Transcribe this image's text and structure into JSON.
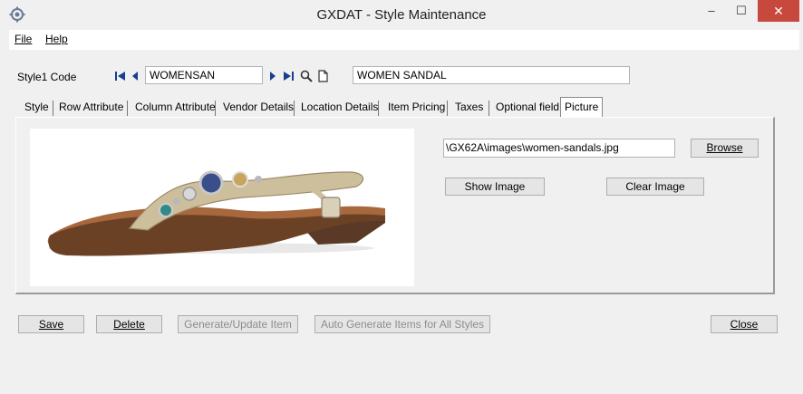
{
  "window": {
    "title": "GXDAT - Style Maintenance",
    "minimize": "–",
    "maximize": "☐",
    "close": "✕"
  },
  "menu": {
    "file": "File",
    "help": "Help"
  },
  "style_code": {
    "label": "Style1 Code",
    "code_value": "WOMENSAN",
    "description_value": "WOMEN SANDAL"
  },
  "tabs": [
    {
      "label": "Style",
      "active": false
    },
    {
      "label": "Row Attribute",
      "active": false
    },
    {
      "label": "Column Attribute",
      "active": false
    },
    {
      "label": "Vendor Details",
      "active": false
    },
    {
      "label": "Location Details",
      "active": false
    },
    {
      "label": "Item Pricing",
      "active": false
    },
    {
      "label": "Taxes",
      "active": false
    },
    {
      "label": "Optional field",
      "active": false
    },
    {
      "label": "Picture",
      "active": true
    }
  ],
  "picture": {
    "path_value": "\\GX62A\\images\\women-sandals.jpg",
    "browse_label": "Browse",
    "show_image_label": "Show Image",
    "clear_image_label": "Clear Image"
  },
  "actions": {
    "save_label": "Save",
    "delete_label": "Delete",
    "generate_update_label": "Generate/Update Item",
    "auto_generate_label": "Auto Generate Items for All Styles",
    "close_label": "Close"
  },
  "colors": {
    "close_button": "#c7483d",
    "nav_arrow": "#1a3d8f"
  }
}
